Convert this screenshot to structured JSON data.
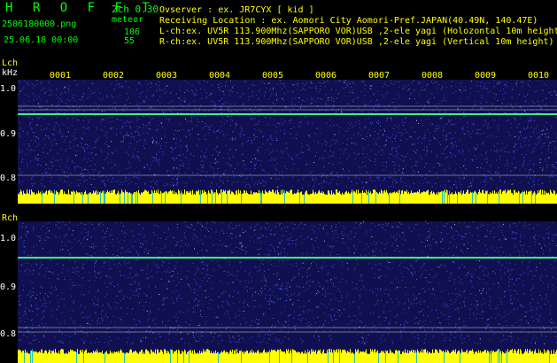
{
  "header": {
    "app_title": "H R O F F T",
    "channel_mode": "2ch 0.30",
    "filename": "2506180000.png",
    "meteor_label": "meteor",
    "datetime": "25.06.18 00:00",
    "meteor_count_l": "106",
    "meteor_count_r": "55"
  },
  "info": {
    "observer": "Ovserver               : ex. JR7CYX [ kid ]",
    "location": "Receiving Location : ex. Aomori City Aomori-Pref.JAPAN(40.49N, 140.47E)",
    "lch": "L-ch:ex. UV5R 113.900Mhz(SAPPORO VOR)USB ,2-ele yagi (Holozontal 10m height)",
    "rch": "R-ch:ex. UV5R 113.900Mhz(SAPPORO VOR)USB ,2-ele yagi (Vertical 10m height)"
  },
  "time_ticks": [
    "0001",
    "0002",
    "0003",
    "0004",
    "0005",
    "0006",
    "0007",
    "0008",
    "0009",
    "0010"
  ],
  "lch_panel": {
    "name": "Lch",
    "unit": "kHz",
    "y_ticks": [
      "1.0",
      "0.9",
      "0.8"
    ]
  },
  "rch_panel": {
    "name": "Rch",
    "y_ticks": [
      "1.0",
      "0.9",
      "0.8"
    ]
  },
  "colors": {
    "background": "#000000",
    "spectrogram_bg": "#101050",
    "noise": "#3a4ad8",
    "carrier": "#40ff80",
    "level": "#ffff00",
    "grid": "#ffffff"
  }
}
